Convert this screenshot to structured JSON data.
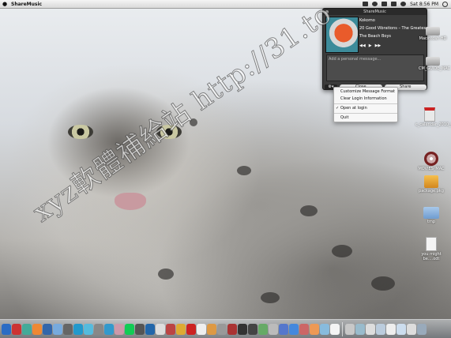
{
  "menubar": {
    "apple": "",
    "app_name": "ShareMusic",
    "clock": "Sat 8:56 PM",
    "icons": [
      "sharemusic-menu-icon",
      "airport-icon",
      "volume-icon",
      "battery-icon",
      "bluetooth-icon",
      "spotlight-search-icon"
    ]
  },
  "panel": {
    "title": "ShareMusic",
    "track": {
      "title": "Kokomo",
      "album": "20 Good Vibrations – The Greatest H",
      "artist": "The Beach Boys"
    },
    "transport": [
      "previous-icon",
      "play-pause-icon",
      "next-icon"
    ],
    "message_placeholder": "Add a personal message...",
    "close_label": "Close",
    "share_label": "Share"
  },
  "menu": {
    "items": [
      {
        "label": "Customize Message Format",
        "checked": false
      },
      {
        "label": "Clear Login Information",
        "checked": false
      },
      {
        "label": "Open at login",
        "checked": true
      },
      {
        "label": "Quit",
        "checked": false
      }
    ]
  },
  "desktop_icons": [
    {
      "label": "Macintosh HD",
      "icon": "hard-drive-icon"
    },
    {
      "label": "CM_GUIDE_MAC",
      "icon": "drive-icon"
    },
    {
      "label": "c_calendar_2010_2011.pdf",
      "icon": "pdf-file-icon"
    },
    {
      "label": "MOVIES_MAC",
      "icon": "dvd-icon"
    },
    {
      "label": "package.pkg",
      "icon": "package-icon"
    },
    {
      "label": "tmp",
      "icon": "folder-icon"
    },
    {
      "label": "you might be....odt",
      "icon": "document-icon"
    }
  ],
  "watermark": "xyz軟體補給站 http://31.to",
  "colors": {
    "panel_bg": "#3b3b3b",
    "menu_bg": "#f8f8f8",
    "share_button": "#e8e8e8"
  }
}
